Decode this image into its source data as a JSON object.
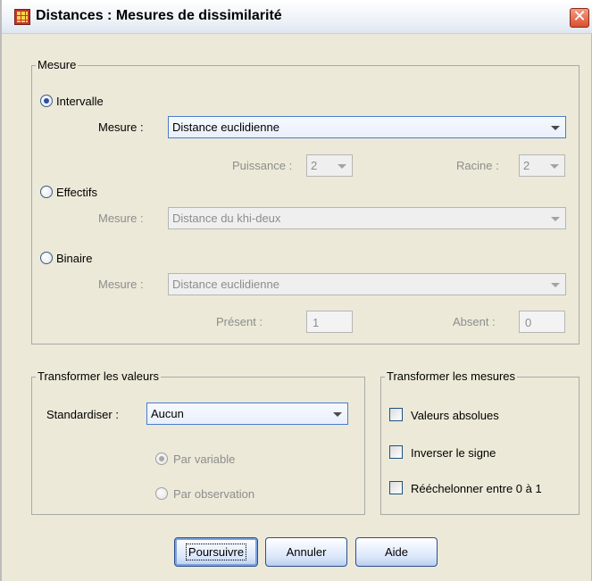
{
  "window": {
    "title": "Distances : Mesures de dissimilarité"
  },
  "mesure": {
    "legend": "Mesure",
    "intervalle": {
      "label": "Intervalle",
      "measure_label": "Mesure :",
      "measure_value": "Distance euclidienne",
      "power_label": "Puissance :",
      "power_value": "2",
      "root_label": "Racine :",
      "root_value": "2"
    },
    "effectifs": {
      "label": "Effectifs",
      "measure_label": "Mesure :",
      "measure_value": "Distance du khi-deux"
    },
    "binaire": {
      "label": "Binaire",
      "measure_label": "Mesure :",
      "measure_value": "Distance euclidienne",
      "present_label": "Présent :",
      "present_value": "1",
      "absent_label": "Absent :",
      "absent_value": "0"
    }
  },
  "transform_values": {
    "legend": "Transformer les valeurs",
    "standardize_label": "Standardiser :",
    "standardize_value": "Aucun",
    "by_variable": "Par variable",
    "by_case": "Par observation"
  },
  "transform_measures": {
    "legend": "Transformer les mesures",
    "absolute": "Valeurs absolues",
    "reverse": "Inverser le signe",
    "rescale": "Rééchelonner entre 0 à 1"
  },
  "buttons": {
    "continue": "Poursuivre",
    "cancel": "Annuler",
    "help": "Aide"
  },
  "icons": {
    "app": "spss-table-icon",
    "close": "close-icon"
  }
}
